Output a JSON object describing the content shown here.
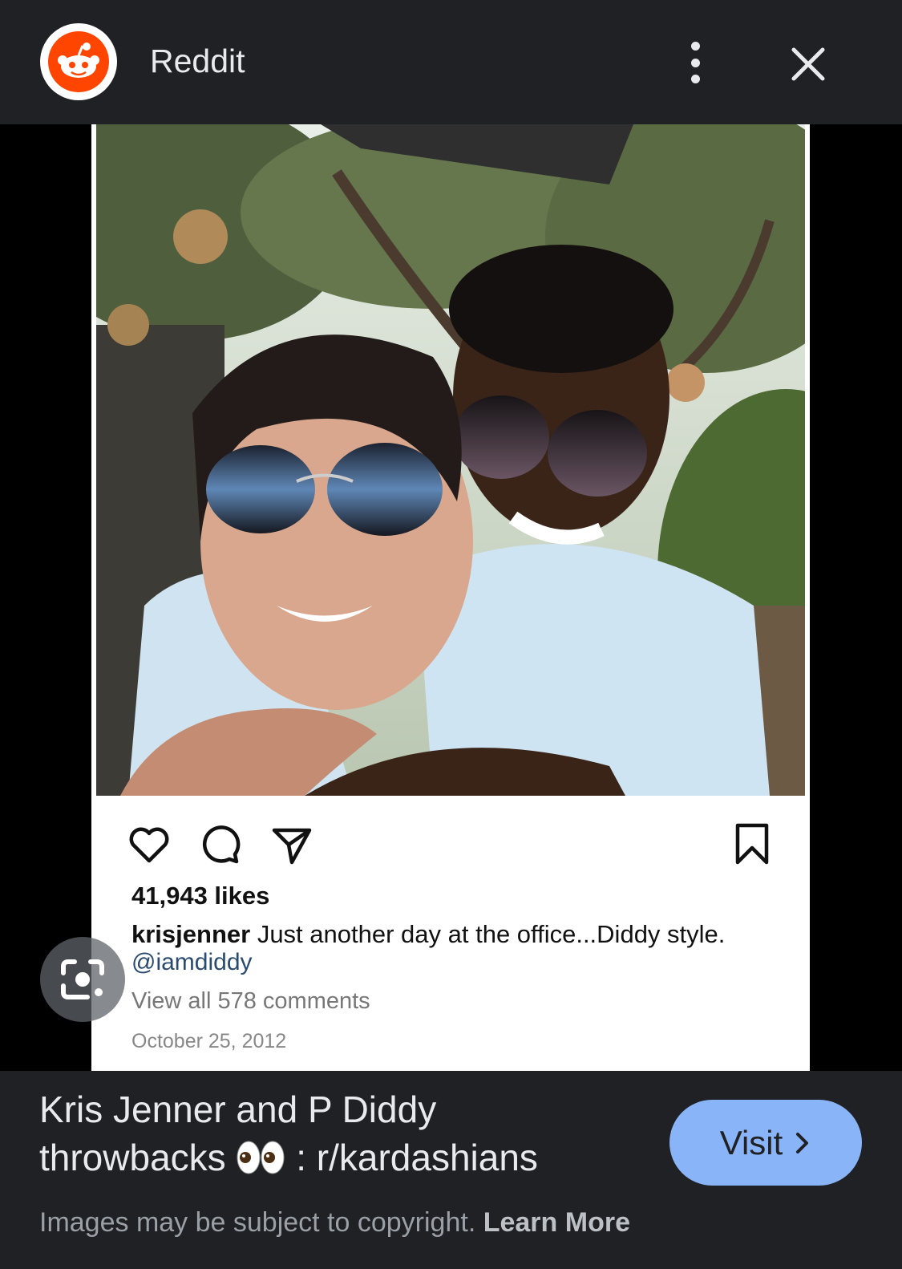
{
  "header": {
    "site_name": "Reddit",
    "more_icon": "more-vert-icon",
    "close_icon": "close-icon"
  },
  "post": {
    "photo_alt": "Selfie of Kris Jenner and P Diddy",
    "likes": "41,943 likes",
    "username": "krisjenner",
    "caption": " Just another day at the office...Diddy style.",
    "mention": "@iamdiddy",
    "view_comments": "View all 578 comments",
    "date": "October 25, 2012",
    "icons": [
      "heart-icon",
      "comment-icon",
      "share-icon",
      "bookmark-icon"
    ]
  },
  "result": {
    "title_line1": "Kris Jenner and P Diddy",
    "title_line2_prefix": "throwbacks ",
    "title_line2_suffix": " : r/kardashians",
    "visit_label": "Visit",
    "copyright_text": "Images may be subject to copyright. ",
    "learn_more_label": "Learn More"
  },
  "colors": {
    "reddit_orange": "#ff4500",
    "visit_button": "#8ab4f8",
    "panel_bg": "#202124"
  }
}
